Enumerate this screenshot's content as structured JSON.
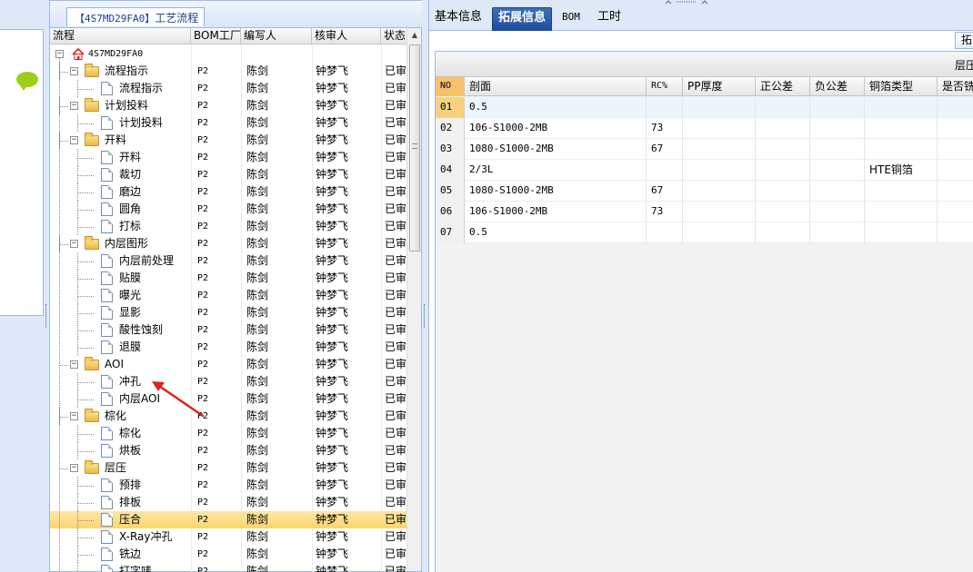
{
  "left_panel": {
    "icon": "chat-bubble-icon"
  },
  "tree_panel": {
    "tab_label_code": "【4S7MD29FA0】",
    "tab_label_text": "工艺流程",
    "columns": [
      "流程",
      "BOM工厂",
      "编写人",
      "核审人",
      "状态"
    ],
    "root_label": "4S7MD29FA0",
    "rows": [
      {
        "label": "流程指示",
        "type": "folder",
        "bom": "P2",
        "writer": "陈剑",
        "checker": "钟梦飞",
        "status": "已审"
      },
      {
        "label": "流程指示",
        "type": "doc",
        "bom": "P2",
        "writer": "陈剑",
        "checker": "钟梦飞",
        "status": "已审"
      },
      {
        "label": "计划投料",
        "type": "folder",
        "bom": "P2",
        "writer": "陈剑",
        "checker": "钟梦飞",
        "status": "已审"
      },
      {
        "label": "计划投料",
        "type": "doc",
        "bom": "P2",
        "writer": "陈剑",
        "checker": "钟梦飞",
        "status": "已审"
      },
      {
        "label": "开料",
        "type": "folder",
        "bom": "P2",
        "writer": "陈剑",
        "checker": "钟梦飞",
        "status": "已审"
      },
      {
        "label": "开料",
        "type": "doc",
        "bom": "P2",
        "writer": "陈剑",
        "checker": "钟梦飞",
        "status": "已审"
      },
      {
        "label": "裁切",
        "type": "doc",
        "bom": "P2",
        "writer": "陈剑",
        "checker": "钟梦飞",
        "status": "已审"
      },
      {
        "label": "磨边",
        "type": "doc",
        "bom": "P2",
        "writer": "陈剑",
        "checker": "钟梦飞",
        "status": "已审"
      },
      {
        "label": "圆角",
        "type": "doc",
        "bom": "P2",
        "writer": "陈剑",
        "checker": "钟梦飞",
        "status": "已审"
      },
      {
        "label": "打标",
        "type": "doc",
        "bom": "P2",
        "writer": "陈剑",
        "checker": "钟梦飞",
        "status": "已审"
      },
      {
        "label": "内层图形",
        "type": "folder",
        "bom": "P2",
        "writer": "陈剑",
        "checker": "钟梦飞",
        "status": "已审"
      },
      {
        "label": "内层前处理",
        "type": "doc",
        "bom": "P2",
        "writer": "陈剑",
        "checker": "钟梦飞",
        "status": "已审"
      },
      {
        "label": "贴膜",
        "type": "doc",
        "bom": "P2",
        "writer": "陈剑",
        "checker": "钟梦飞",
        "status": "已审"
      },
      {
        "label": "曝光",
        "type": "doc",
        "bom": "P2",
        "writer": "陈剑",
        "checker": "钟梦飞",
        "status": "已审"
      },
      {
        "label": "显影",
        "type": "doc",
        "bom": "P2",
        "writer": "陈剑",
        "checker": "钟梦飞",
        "status": "已审"
      },
      {
        "label": "酸性蚀刻",
        "type": "doc",
        "bom": "P2",
        "writer": "陈剑",
        "checker": "钟梦飞",
        "status": "已审"
      },
      {
        "label": "退膜",
        "type": "doc",
        "bom": "P2",
        "writer": "陈剑",
        "checker": "钟梦飞",
        "status": "已审"
      },
      {
        "label": "AOI",
        "type": "folder",
        "bom": "P2",
        "writer": "陈剑",
        "checker": "钟梦飞",
        "status": "已审"
      },
      {
        "label": "冲孔",
        "type": "doc",
        "bom": "P2",
        "writer": "陈剑",
        "checker": "钟梦飞",
        "status": "已审"
      },
      {
        "label": "内层AOI",
        "type": "doc",
        "bom": "P2",
        "writer": "陈剑",
        "checker": "钟梦飞",
        "status": "已审"
      },
      {
        "label": "棕化",
        "type": "folder",
        "bom": "P2",
        "writer": "陈剑",
        "checker": "钟梦飞",
        "status": "已审"
      },
      {
        "label": "棕化",
        "type": "doc",
        "bom": "P2",
        "writer": "陈剑",
        "checker": "钟梦飞",
        "status": "已审"
      },
      {
        "label": "烘板",
        "type": "doc",
        "bom": "P2",
        "writer": "陈剑",
        "checker": "钟梦飞",
        "status": "已审"
      },
      {
        "label": "层压",
        "type": "folder",
        "bom": "P2",
        "writer": "陈剑",
        "checker": "钟梦飞",
        "status": "已审"
      },
      {
        "label": "预排",
        "type": "doc",
        "bom": "P2",
        "writer": "陈剑",
        "checker": "钟梦飞",
        "status": "已审"
      },
      {
        "label": "排板",
        "type": "doc",
        "bom": "P2",
        "writer": "陈剑",
        "checker": "钟梦飞",
        "status": "已审"
      },
      {
        "label": "压合",
        "type": "doc",
        "bom": "P2",
        "writer": "陈剑",
        "checker": "钟梦飞",
        "status": "已审",
        "selected": true
      },
      {
        "label": "X-Ray冲孔",
        "type": "doc",
        "bom": "P2",
        "writer": "陈剑",
        "checker": "钟梦飞",
        "status": "已审"
      },
      {
        "label": "铣边",
        "type": "doc",
        "bom": "P2",
        "writer": "陈剑",
        "checker": "钟梦飞",
        "status": "已审"
      },
      {
        "label": "打字唛",
        "type": "doc",
        "bom": "P2",
        "writer": "陈剑",
        "checker": "钟梦飞",
        "status": "已审"
      }
    ]
  },
  "right_panel": {
    "tabs": [
      "基本信息",
      "拓展信息",
      "BOM",
      "工时"
    ],
    "active_tab": 1,
    "toolbar_button": "拓",
    "grid_title": "层压",
    "columns": [
      "NO",
      "剖面",
      "RC%",
      "PP厚度",
      "正公差",
      "负公差",
      "铜箔类型",
      "是否铣"
    ],
    "rows": [
      {
        "no": "01",
        "section": "0.5",
        "rc": "",
        "pp": "",
        "pos": "",
        "neg": "",
        "foil": "",
        "mill": ""
      },
      {
        "no": "02",
        "section": "106-S1000-2MB",
        "rc": "73",
        "pp": "",
        "pos": "",
        "neg": "",
        "foil": "",
        "mill": ""
      },
      {
        "no": "03",
        "section": "1080-S1000-2MB",
        "rc": "67",
        "pp": "",
        "pos": "",
        "neg": "",
        "foil": "",
        "mill": ""
      },
      {
        "no": "04",
        "section": "2/3L",
        "rc": "",
        "pp": "",
        "pos": "",
        "neg": "",
        "foil": "HTE铜箔",
        "mill": ""
      },
      {
        "no": "05",
        "section": "1080-S1000-2MB",
        "rc": "67",
        "pp": "",
        "pos": "",
        "neg": "",
        "foil": "",
        "mill": ""
      },
      {
        "no": "06",
        "section": "106-S1000-2MB",
        "rc": "73",
        "pp": "",
        "pos": "",
        "neg": "",
        "foil": "",
        "mill": ""
      },
      {
        "no": "07",
        "section": "0.5",
        "rc": "",
        "pp": "",
        "pos": "",
        "neg": "",
        "foil": "",
        "mill": ""
      }
    ]
  },
  "annotation": {
    "color": "#e02020"
  }
}
